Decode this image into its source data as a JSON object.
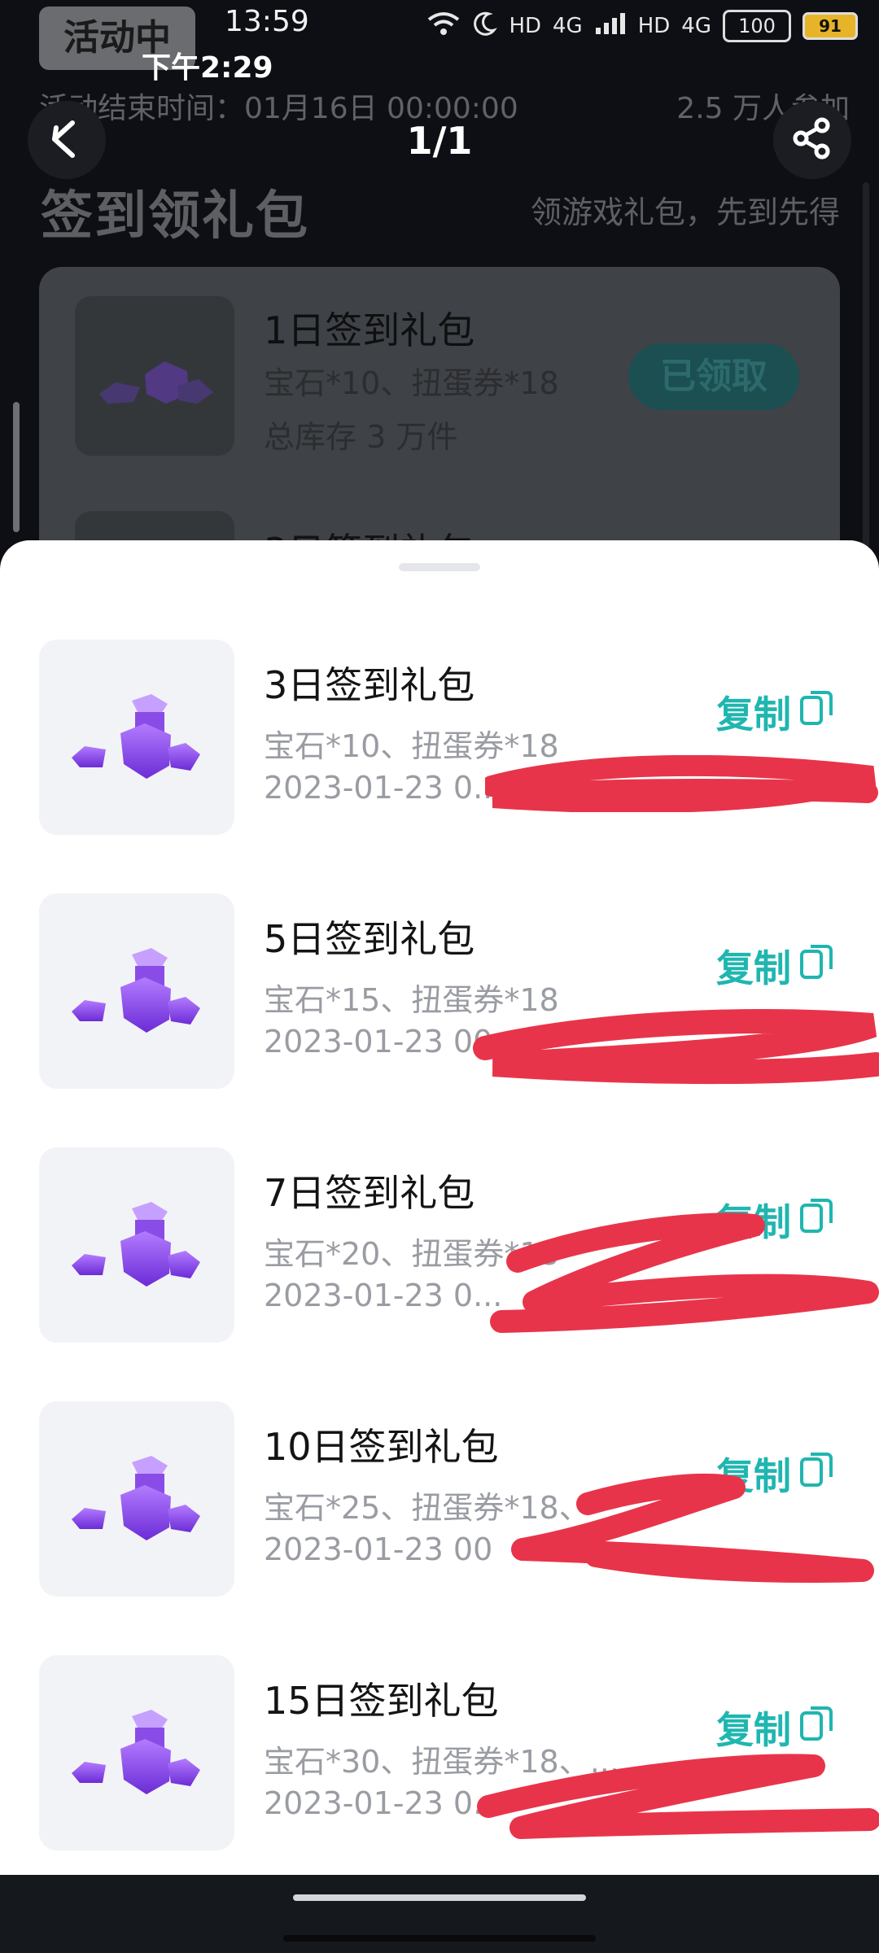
{
  "status_bar": {
    "pill": "活动中",
    "time_top": "13:59",
    "time_secondary": "下午2:29",
    "battery_a": "100",
    "battery_b": "91",
    "net_a": "HD",
    "net_b": "4G",
    "net_c": "HD",
    "net_d": "4G"
  },
  "header": {
    "activity_end": "活动结束时间：01月16日 00:00:00",
    "participants": "2.5 万人参加",
    "page_indicator": "1/1",
    "title": "签到领礼包",
    "subtitle": "领游戏礼包，先到先得"
  },
  "background_card": {
    "name": "1日签到礼包",
    "desc": "宝石*10、扭蛋券*18",
    "stock": "总库存 3 万件",
    "claimed_label": "已领取",
    "next_name_partial": "3日签到礼包"
  },
  "sheet": {
    "copy_label": "复制",
    "items": [
      {
        "name": "3日签到礼包",
        "desc": "宝石*10、扭蛋券*18",
        "date": "2023-01-23 0..."
      },
      {
        "name": "5日签到礼包",
        "desc": "宝石*15、扭蛋券*18",
        "date": "2023-01-23 00"
      },
      {
        "name": "7日签到礼包",
        "desc": "宝石*20、扭蛋券*18",
        "date": "2023-01-23 0..."
      },
      {
        "name": "10日签到礼包",
        "desc": "宝石*25、扭蛋券*18、",
        "date": "2023-01-23 00"
      },
      {
        "name": "15日签到礼包",
        "desc": "宝石*30、扭蛋券*18、...",
        "date": "2023-01-23 0..."
      }
    ]
  },
  "colors": {
    "accent": "#1fb6b0",
    "redaction": "#e8344a"
  },
  "icons": [
    "back-arrow-icon",
    "share-icon",
    "copy-icon",
    "wifi-icon",
    "moon-icon",
    "signal-icon",
    "battery-icon",
    "qq-icon",
    "gem-icon"
  ]
}
